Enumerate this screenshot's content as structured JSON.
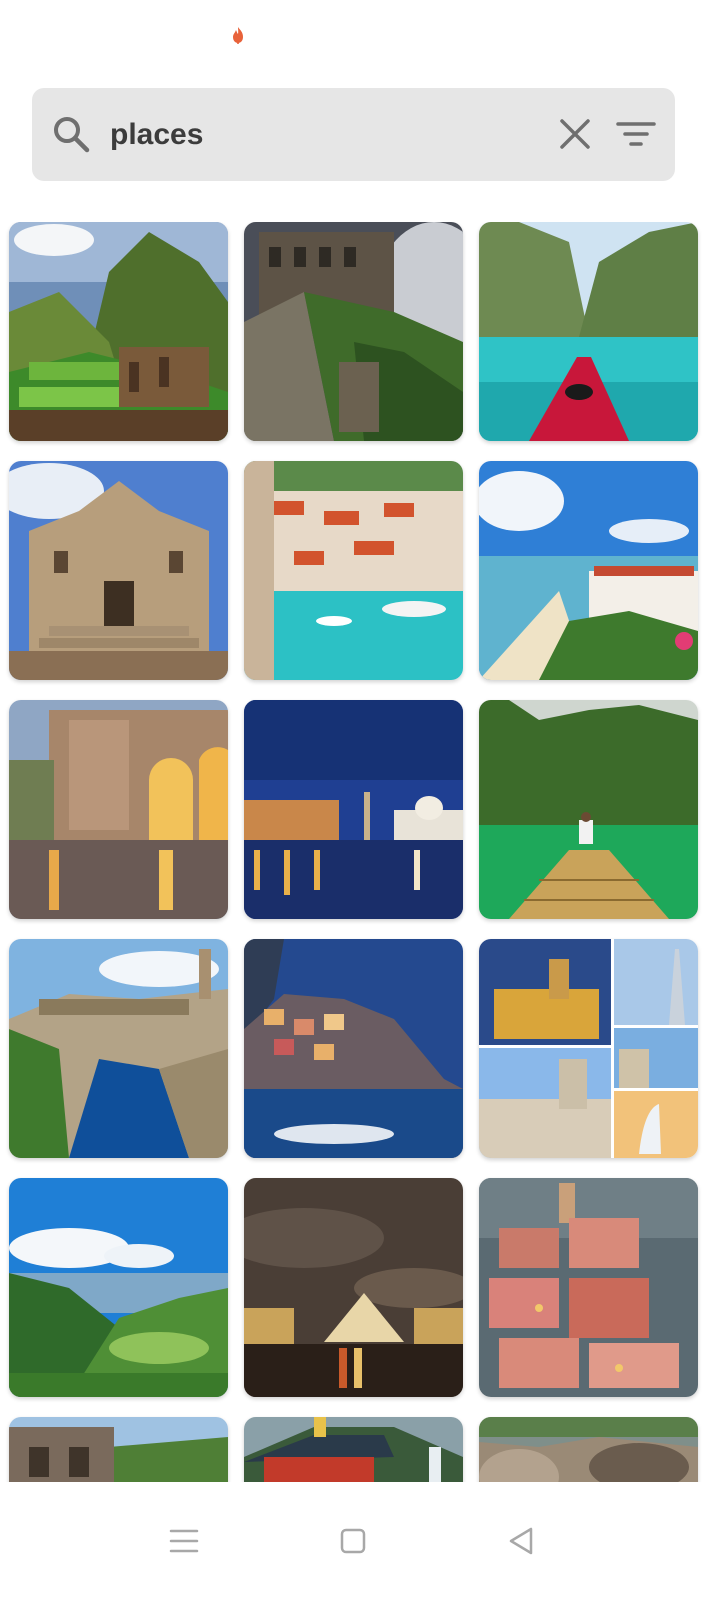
{
  "search": {
    "query": "places",
    "icons": {
      "leading": "search-icon",
      "clear": "close-icon",
      "filter": "filter-icon"
    }
  },
  "status_bar": {
    "icon": "notification-flame-icon",
    "icon_color": "#e8623a"
  },
  "results": [
    {
      "name": "mountain-ruins-terraces"
    },
    {
      "name": "stone-castle-cliff-fog"
    },
    {
      "name": "kayak-lagoon-cliffs"
    },
    {
      "name": "ornate-palace-staircase"
    },
    {
      "name": "harbor-town-boats"
    },
    {
      "name": "seaside-beach-resort"
    },
    {
      "name": "canal-arches-night"
    },
    {
      "name": "city-skyline-night-river"
    },
    {
      "name": "bamboo-raft-green-lagoon"
    },
    {
      "name": "fortress-river-gorge"
    },
    {
      "name": "cliffside-village-dusk"
    },
    {
      "name": "desert-city-collage"
    },
    {
      "name": "green-hills-lake"
    },
    {
      "name": "glass-pyramid-night"
    },
    {
      "name": "red-roof-hill-town"
    },
    {
      "name": "old-house-hillside"
    },
    {
      "name": "temple-pagoda-waterfall"
    },
    {
      "name": "rocky-coastline"
    }
  ],
  "navigation": {
    "icons": [
      "menu-icon",
      "home-icon",
      "back-icon"
    ]
  },
  "colors": {
    "search_background": "#e6e6e6",
    "icon_gray": "#6f6f6f",
    "nav_gray": "#a8a8a8"
  }
}
